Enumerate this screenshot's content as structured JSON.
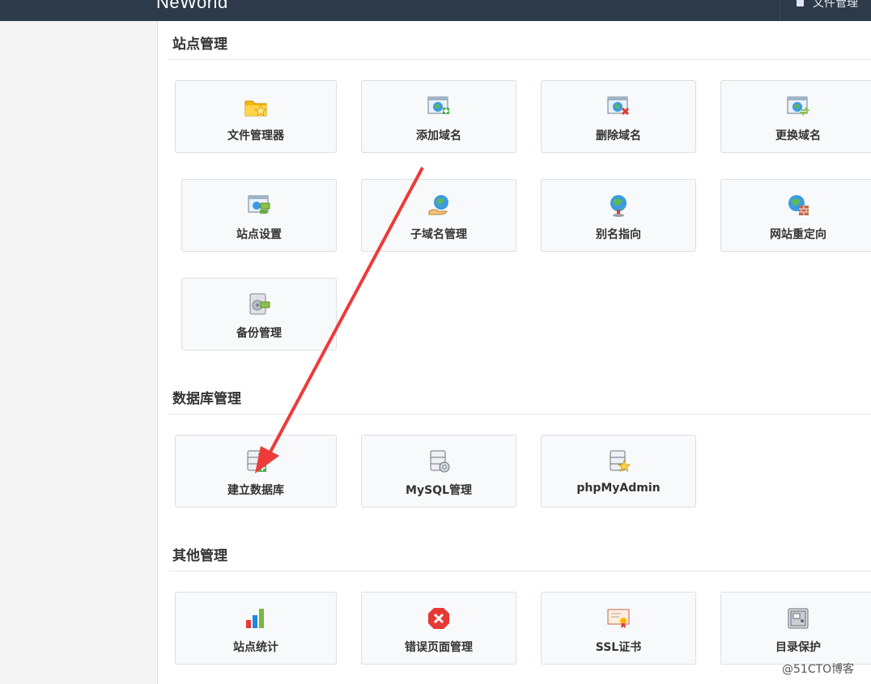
{
  "header": {
    "brand": "NeWorld",
    "file_manager": "文件管理"
  },
  "sections": [
    {
      "title": "站点管理",
      "tiles": [
        {
          "label": "文件管理器",
          "icon": "folder-star-icon"
        },
        {
          "label": "添加域名",
          "icon": "window-globe-add-icon"
        },
        {
          "label": "删除域名",
          "icon": "window-globe-delete-icon"
        },
        {
          "label": "更换域名",
          "icon": "window-globe-swap-icon"
        },
        {
          "label": "站点设置",
          "icon": "window-settings-icon"
        },
        {
          "label": "子域名管理",
          "icon": "globe-hand-icon"
        },
        {
          "label": "别名指向",
          "icon": "globe-pin-icon"
        },
        {
          "label": "网站重定向",
          "icon": "globe-wall-icon"
        },
        {
          "label": "备份管理",
          "icon": "backup-disk-icon"
        }
      ]
    },
    {
      "title": "数据库管理",
      "tiles": [
        {
          "label": "建立数据库",
          "icon": "database-add-icon"
        },
        {
          "label": "MySQL管理",
          "icon": "database-gear-icon"
        },
        {
          "label": "phpMyAdmin",
          "icon": "database-star-icon"
        }
      ]
    },
    {
      "title": "其他管理",
      "tiles": [
        {
          "label": "站点统计",
          "icon": "bar-chart-icon"
        },
        {
          "label": "错误页面管理",
          "icon": "error-x-icon"
        },
        {
          "label": "SSL证书",
          "icon": "certificate-icon"
        },
        {
          "label": "目录保护",
          "icon": "safe-icon"
        }
      ]
    }
  ],
  "watermark": "@51CTO博客",
  "colors": {
    "topbar": "#2c3a4a",
    "arrow": "#ee3a3a",
    "tile_bg": "#f8f9fa",
    "tile_border": "#dcdfe2"
  }
}
